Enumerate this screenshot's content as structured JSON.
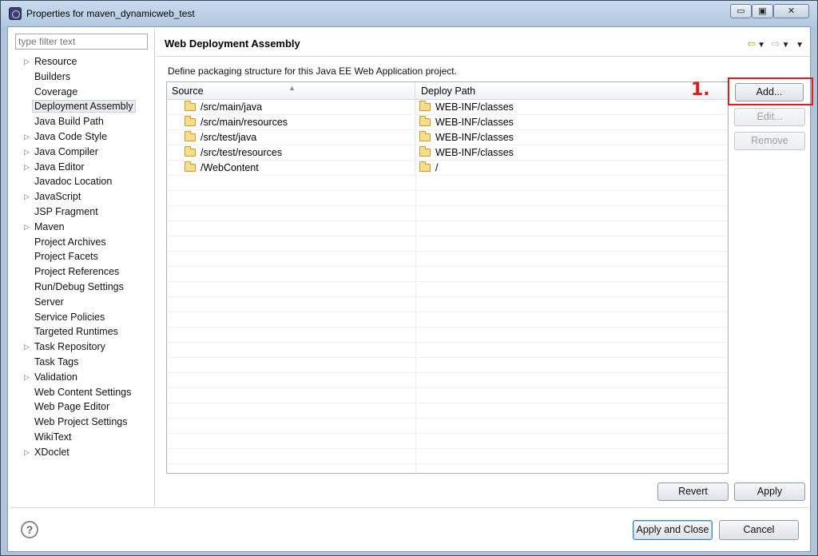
{
  "window": {
    "title": "Properties for maven_dynamicweb_test",
    "minimize_label": "▭",
    "maximize_label": "▣",
    "close_label": "✕"
  },
  "filter": {
    "placeholder": "type filter text"
  },
  "tree": {
    "items": [
      {
        "label": "Resource",
        "expandable": true
      },
      {
        "label": "Builders",
        "expandable": false
      },
      {
        "label": "Coverage",
        "expandable": false
      },
      {
        "label": "Deployment Assembly",
        "expandable": false,
        "selected": true
      },
      {
        "label": "Java Build Path",
        "expandable": false
      },
      {
        "label": "Java Code Style",
        "expandable": true
      },
      {
        "label": "Java Compiler",
        "expandable": true
      },
      {
        "label": "Java Editor",
        "expandable": true
      },
      {
        "label": "Javadoc Location",
        "expandable": false
      },
      {
        "label": "JavaScript",
        "expandable": true
      },
      {
        "label": "JSP Fragment",
        "expandable": false
      },
      {
        "label": "Maven",
        "expandable": true
      },
      {
        "label": "Project Archives",
        "expandable": false
      },
      {
        "label": "Project Facets",
        "expandable": false
      },
      {
        "label": "Project References",
        "expandable": false
      },
      {
        "label": "Run/Debug Settings",
        "expandable": false
      },
      {
        "label": "Server",
        "expandable": false
      },
      {
        "label": "Service Policies",
        "expandable": false
      },
      {
        "label": "Targeted Runtimes",
        "expandable": false
      },
      {
        "label": "Task Repository",
        "expandable": true
      },
      {
        "label": "Task Tags",
        "expandable": false
      },
      {
        "label": "Validation",
        "expandable": true
      },
      {
        "label": "Web Content Settings",
        "expandable": false
      },
      {
        "label": "Web Page Editor",
        "expandable": false
      },
      {
        "label": "Web Project Settings",
        "expandable": false
      },
      {
        "label": "WikiText",
        "expandable": false
      },
      {
        "label": "XDoclet",
        "expandable": true
      }
    ]
  },
  "page": {
    "title": "Web Deployment Assembly",
    "description": "Define packaging structure for this Java EE Web Application project."
  },
  "table": {
    "columns": [
      "Source",
      "Deploy Path"
    ],
    "rows": [
      {
        "source": "/src/main/java",
        "deploy": "WEB-INF/classes"
      },
      {
        "source": "/src/main/resources",
        "deploy": "WEB-INF/classes"
      },
      {
        "source": "/src/test/java",
        "deploy": "WEB-INF/classes"
      },
      {
        "source": "/src/test/resources",
        "deploy": "WEB-INF/classes"
      },
      {
        "source": "/WebContent",
        "deploy": "/"
      }
    ],
    "empty_rows": 20
  },
  "buttons": {
    "add": "Add...",
    "edit": "Edit...",
    "remove": "Remove",
    "revert": "Revert",
    "apply": "Apply",
    "apply_close": "Apply and Close",
    "cancel": "Cancel",
    "help": "?"
  },
  "annotation": {
    "text": "1.",
    "color": "#e01a1a"
  }
}
